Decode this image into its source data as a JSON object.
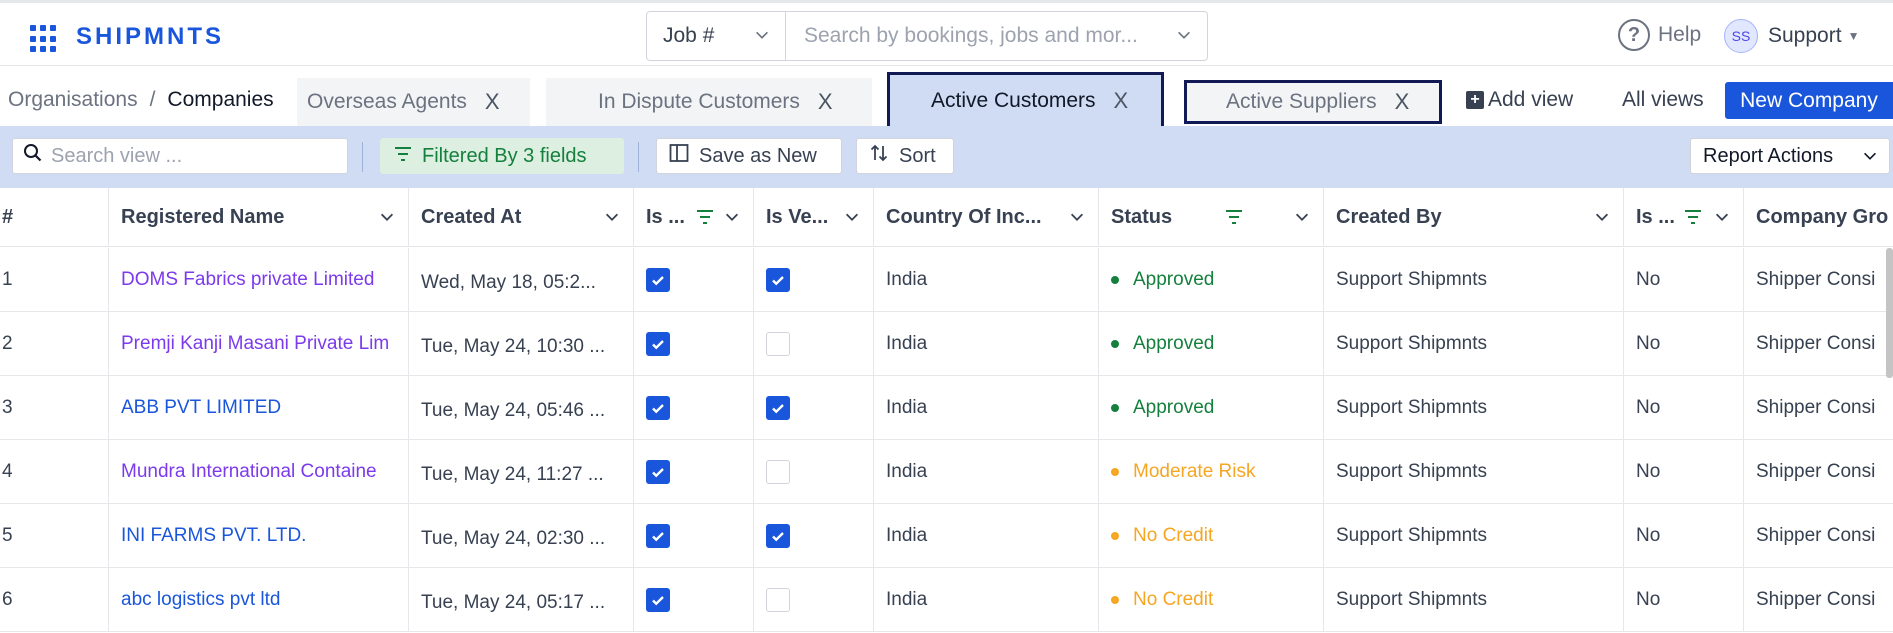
{
  "header": {
    "logo": "SHIPMNTS",
    "job_select": "Job #",
    "search_placeholder": "Search by bookings, jobs and mor...",
    "help": "Help",
    "help_icon": "?",
    "user_initials": "SS",
    "user_name": "Support"
  },
  "breadcrumb": {
    "parent": "Organisations",
    "separator": "/",
    "current": "Companies"
  },
  "tabs": [
    {
      "label": "Overseas Agents",
      "close": "X"
    },
    {
      "label": "In Dispute Customers",
      "close": "X"
    },
    {
      "label": "Active Customers",
      "close": "X"
    },
    {
      "label": "Active Suppliers",
      "close": "X"
    }
  ],
  "toolbar": {
    "add_view": "Add view",
    "add_view_plus": "+",
    "all_views": "All views",
    "new_company": "New Company"
  },
  "filterbar": {
    "search_placeholder": "Search view ...",
    "filtered": "Filtered By 3 fields",
    "save_as_new": "Save as New",
    "sort": "Sort",
    "report_actions": "Report Actions"
  },
  "table": {
    "columns": [
      "#",
      "Registered Name",
      "Created At",
      "Is ...",
      "Is Ve...",
      "Country Of Inc...",
      "Status",
      "Created By",
      "Is ...",
      "Company Gro"
    ],
    "rows": [
      {
        "num": "1",
        "name": "DOMS Fabrics private Limited",
        "name_color": "purple",
        "created_at": "Wed, May 18, 05:2...",
        "is1": true,
        "is_ve": true,
        "country": "India",
        "status": "Approved",
        "status_kind": "ok",
        "created_by": "Support Shipmnts",
        "is2": "No",
        "group": "Shipper Consi"
      },
      {
        "num": "2",
        "name": "Premji Kanji Masani Private Lim",
        "name_color": "purple",
        "created_at": "Tue, May 24, 10:30 ...",
        "is1": true,
        "is_ve": false,
        "country": "India",
        "status": "Approved",
        "status_kind": "ok",
        "created_by": "Support Shipmnts",
        "is2": "No",
        "group": "Shipper Consi"
      },
      {
        "num": "3",
        "name": "ABB PVT LIMITED",
        "name_color": "blue",
        "created_at": "Tue, May 24, 05:46 ...",
        "is1": true,
        "is_ve": true,
        "country": "India",
        "status": "Approved",
        "status_kind": "ok",
        "created_by": "Support Shipmnts",
        "is2": "No",
        "group": "Shipper Consi"
      },
      {
        "num": "4",
        "name": "Mundra International Containe",
        "name_color": "purple",
        "created_at": "Tue, May 24, 11:27 ...",
        "is1": true,
        "is_ve": false,
        "country": "India",
        "status": "Moderate Risk",
        "status_kind": "warn",
        "created_by": "Support Shipmnts",
        "is2": "No",
        "group": "Shipper Consi"
      },
      {
        "num": "5",
        "name": "INI FARMS PVT. LTD.",
        "name_color": "blue",
        "created_at": "Tue, May 24, 02:30 ...",
        "is1": true,
        "is_ve": true,
        "country": "India",
        "status": "No Credit",
        "status_kind": "warn",
        "created_by": "Support Shipmnts",
        "is2": "No",
        "group": "Shipper Consi"
      },
      {
        "num": "6",
        "name": "abc logistics pvt ltd",
        "name_color": "blue",
        "created_at": "Tue, May 24, 05:17 ...",
        "is1": true,
        "is_ve": false,
        "country": "India",
        "status": "No Credit",
        "status_kind": "warn",
        "created_by": "Support Shipmnts",
        "is2": "No",
        "group": "Shipper Consi"
      }
    ]
  },
  "colors": {
    "brand": "#1a56db",
    "approved": "#15803d",
    "warning": "#f5a623",
    "tab_highlight": "#cfdcf3",
    "outline": "#111a55"
  }
}
